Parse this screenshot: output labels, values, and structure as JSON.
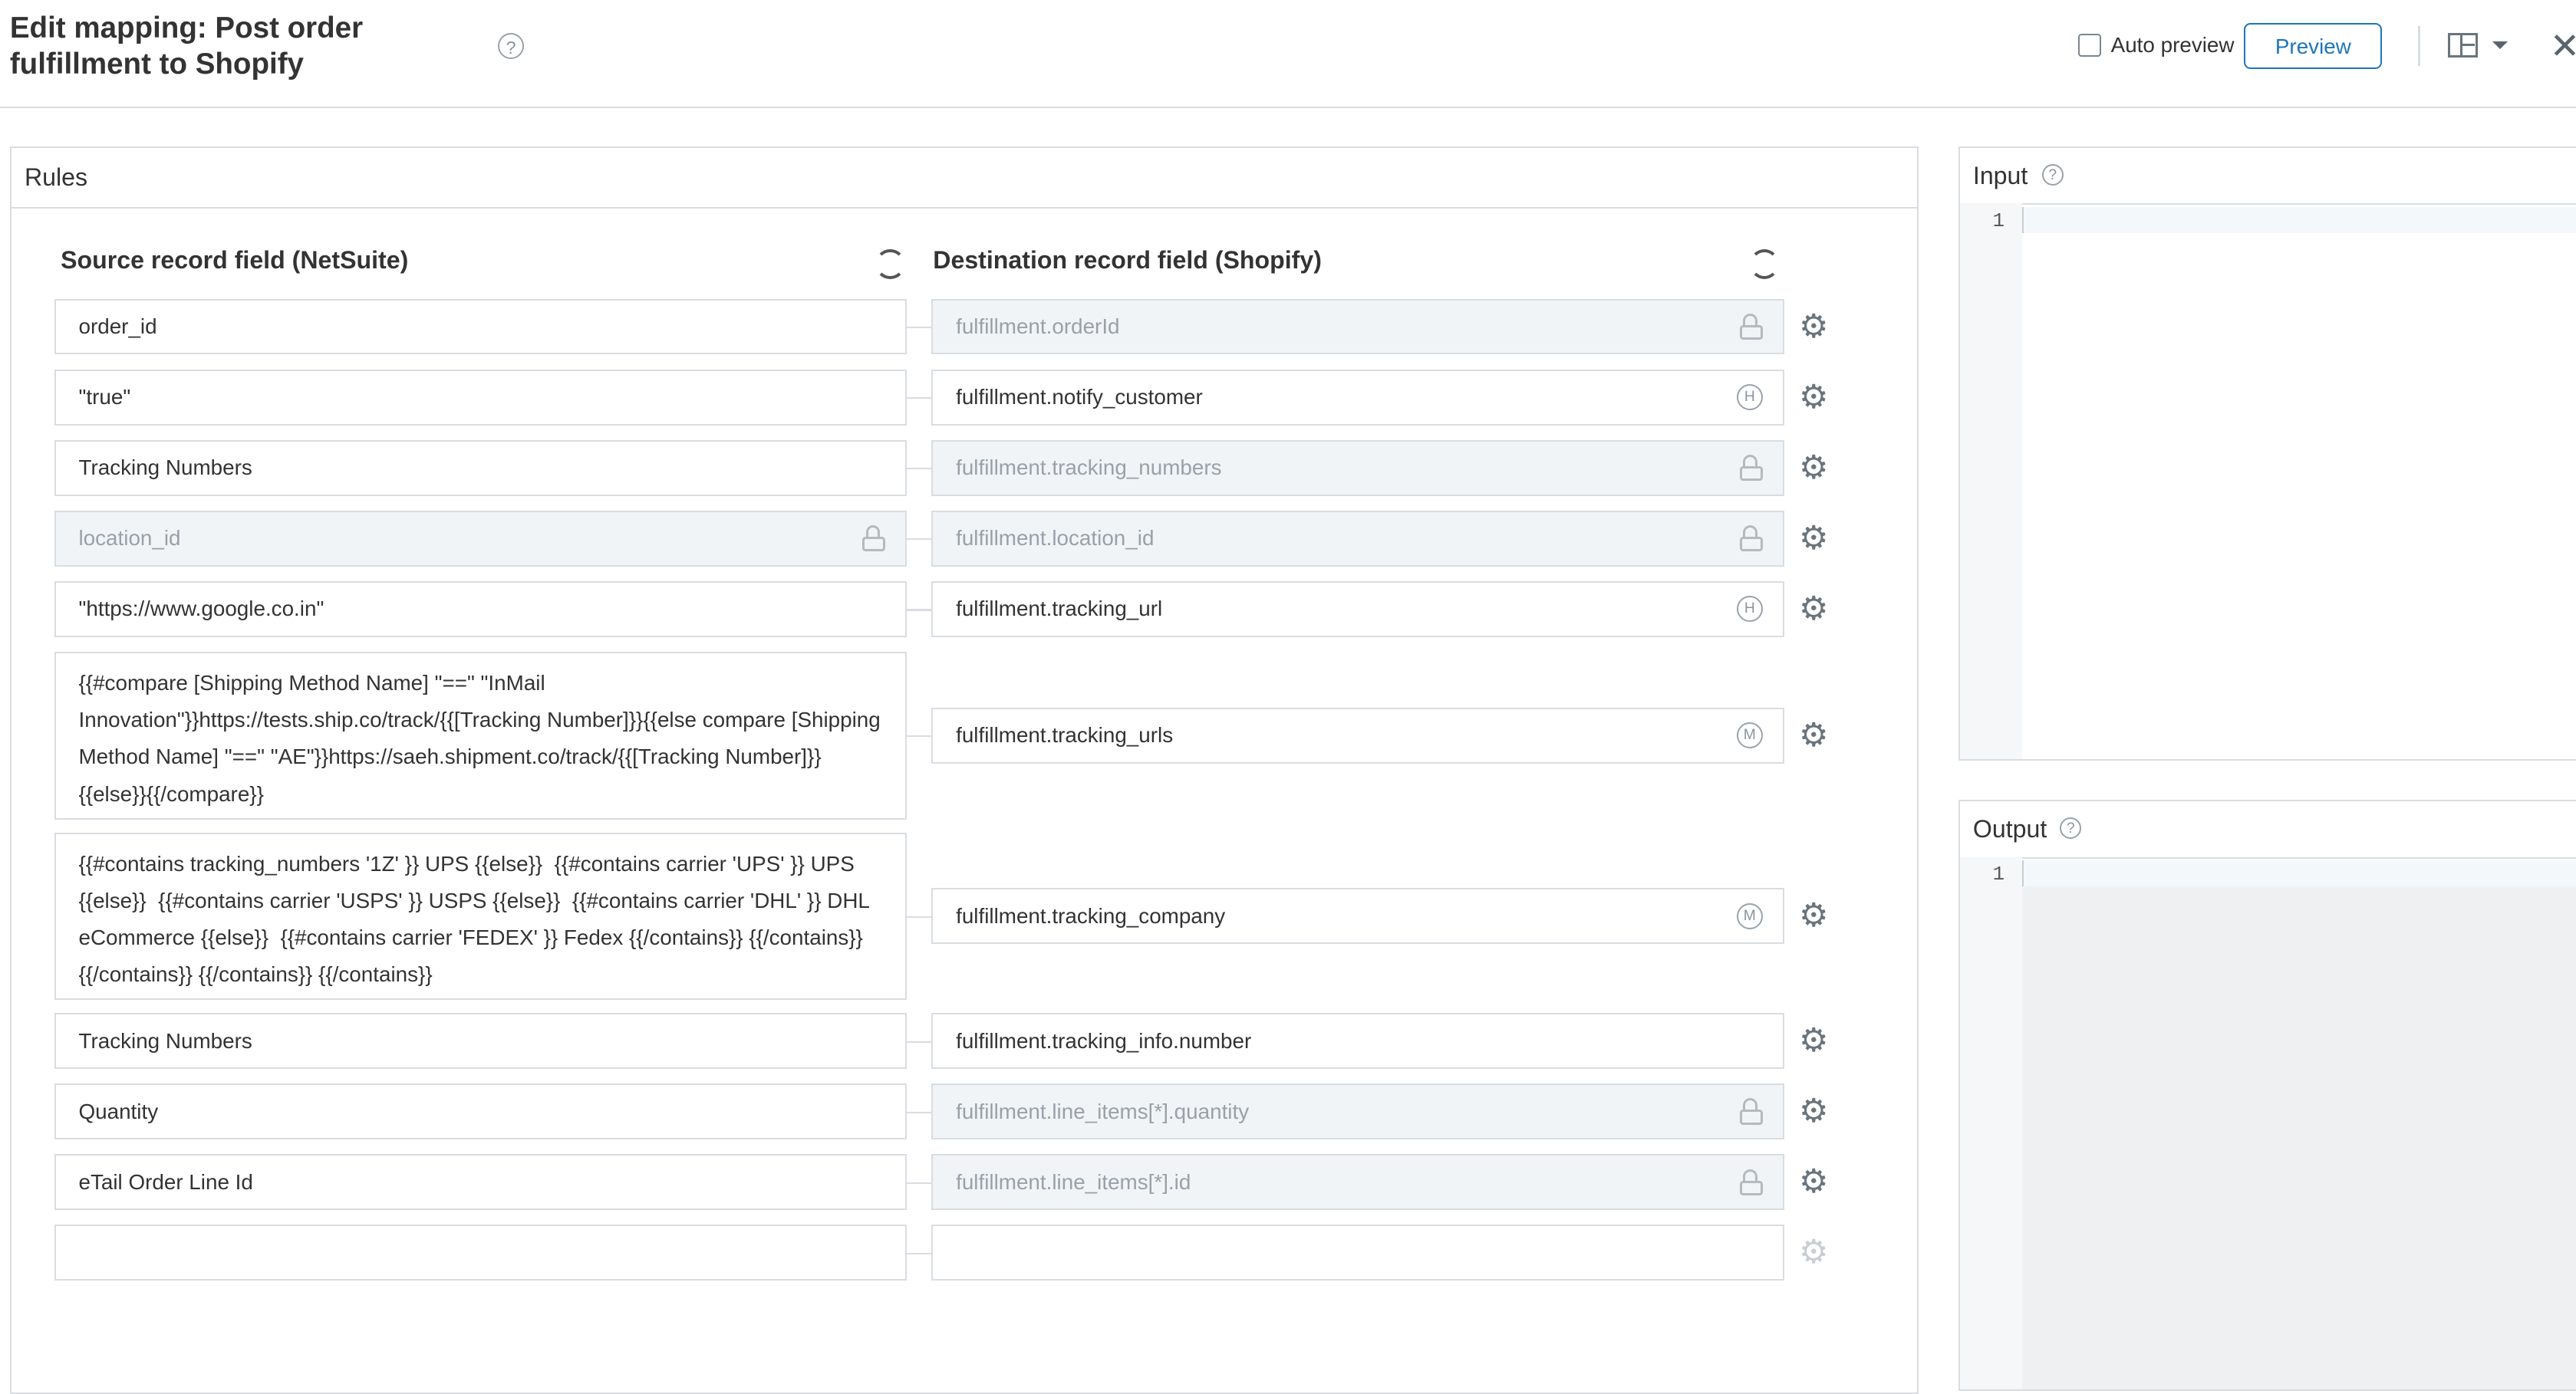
{
  "header": {
    "title": "Edit mapping: Post order fulfillment to Shopify",
    "help": "?",
    "auto_preview_label": "Auto preview",
    "auto_preview_checked": false,
    "preview_label": "Preview",
    "close_glyph": "✕"
  },
  "rules": {
    "title": "Rules",
    "source_header": "Source record field (NetSuite)",
    "destination_header": "Destination record field (Shopify)",
    "rows": [
      {
        "source": "order_id",
        "source_locked": false,
        "destination": "fulfillment.orderId",
        "destination_locked": true,
        "badge": ""
      },
      {
        "source": "\"true\"",
        "source_locked": false,
        "destination": "fulfillment.notify_customer",
        "destination_locked": false,
        "badge": "H"
      },
      {
        "source": "Tracking Numbers",
        "source_locked": false,
        "destination": "fulfillment.tracking_numbers",
        "destination_locked": true,
        "badge": ""
      },
      {
        "source": "location_id",
        "source_locked": true,
        "destination": "fulfillment.location_id",
        "destination_locked": true,
        "badge": ""
      },
      {
        "source": "\"https://www.google.co.in\"",
        "source_locked": false,
        "destination": "fulfillment.tracking_url",
        "destination_locked": false,
        "badge": "H"
      },
      {
        "source": "{{#compare [Shipping Method Name] \"==\" \"InMail Innovation\"}}https://tests.ship.co/track/{{[Tracking Number]}}{{else compare [Shipping Method Name] \"==\" \"AE\"}}https://saeh.shipment.co/track/{{[Tracking Number]}}{{else}}{{/compare}}",
        "source_locked": false,
        "destination": "fulfillment.tracking_urls",
        "destination_locked": false,
        "badge": "M"
      },
      {
        "source": "{{#contains tracking_numbers '1Z' }} UPS {{else}}  {{#contains carrier 'UPS' }} UPS {{else}}  {{#contains carrier 'USPS' }} USPS {{else}}  {{#contains carrier 'DHL' }} DHL eCommerce {{else}}  {{#contains carrier 'FEDEX' }} Fedex {{/contains}} {{/contains}} {{/contains}} {{/contains}} {{/contains}}",
        "source_locked": false,
        "destination": "fulfillment.tracking_company",
        "destination_locked": false,
        "badge": "M"
      },
      {
        "source": "Tracking Numbers",
        "source_locked": false,
        "destination": "fulfillment.tracking_info.number",
        "destination_locked": false,
        "badge": ""
      },
      {
        "source": "Quantity",
        "source_locked": false,
        "destination": "fulfillment.line_items[*].quantity",
        "destination_locked": true,
        "badge": ""
      },
      {
        "source": "eTail Order Line Id",
        "source_locked": false,
        "destination": "fulfillment.line_items[*].id",
        "destination_locked": true,
        "badge": ""
      },
      {
        "source": "",
        "source_locked": false,
        "destination": "",
        "destination_locked": false,
        "badge": ""
      }
    ]
  },
  "input_panel": {
    "title": "Input",
    "line_number": "1"
  },
  "output_panel": {
    "title": "Output",
    "line_number": "1"
  },
  "icons": {
    "gear": "⚙",
    "help": "help-circle-icon",
    "refresh": "refresh-icon",
    "lock": "lock-icon",
    "layout": "layout-icon"
  }
}
